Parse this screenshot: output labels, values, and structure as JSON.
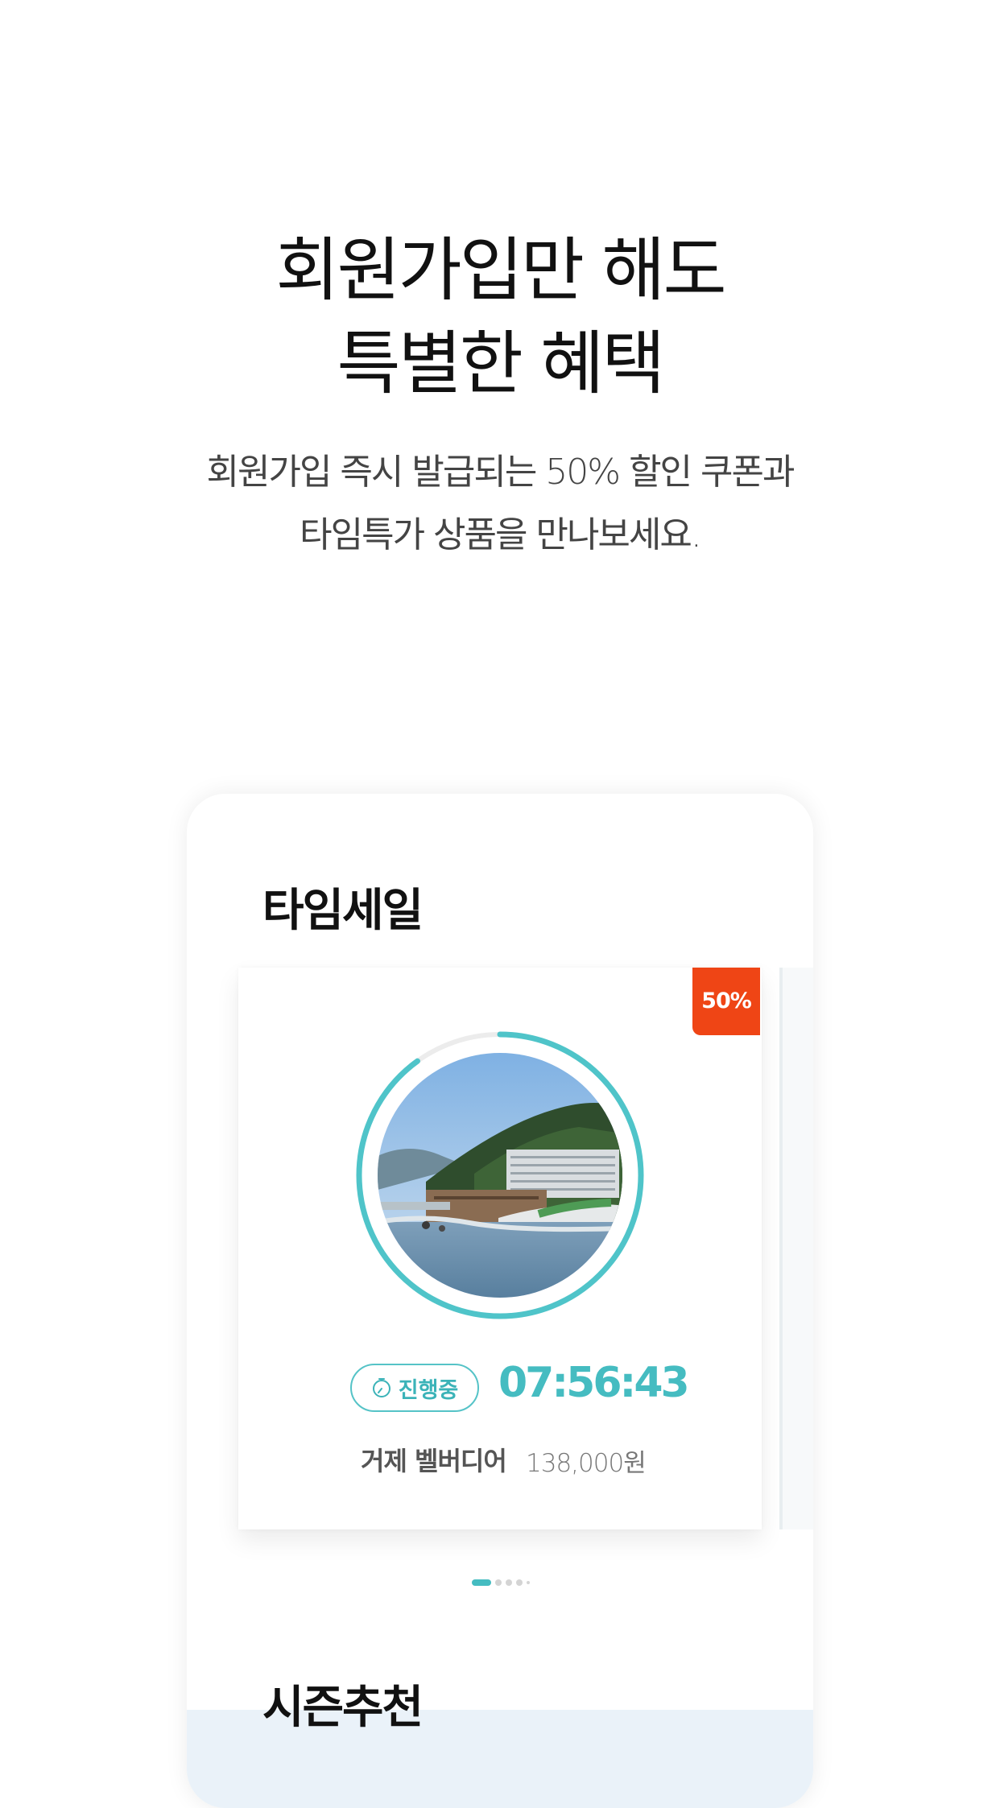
{
  "hero": {
    "title_line1": "회원가입만 해도",
    "title_line2": "특별한 혜택",
    "subtitle_line1": "회원가입 즉시 발급되는 50% 할인 쿠폰과",
    "subtitle_line2": "타임특가 상품을 만나보세요."
  },
  "timesale": {
    "section_title": "타임세일",
    "product": {
      "discount_badge": "50%",
      "status_label": "진행중",
      "countdown": "07:56:43",
      "name": "거제 벨버디어",
      "price": "138,000원",
      "image_icon": "resort-photo",
      "timer_progress": 0.9
    },
    "pager": {
      "count": 4,
      "active_index": 0
    }
  },
  "season": {
    "section_title": "시즌추천"
  },
  "colors": {
    "accent": "#45bcc1",
    "badge": "#ef4515",
    "season_bg": "#eaf2f9"
  }
}
